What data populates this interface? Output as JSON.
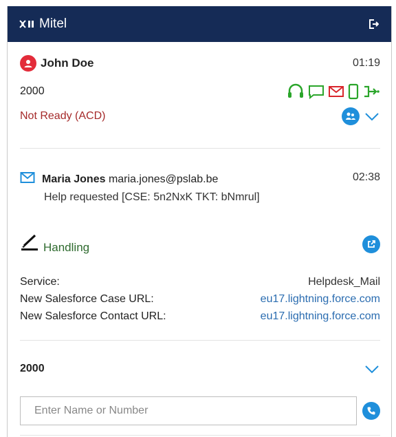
{
  "app": {
    "brand": "Mitel"
  },
  "agent": {
    "name": "John Doe",
    "time": "01:19",
    "extension": "2000",
    "status": "Not Ready (ACD)"
  },
  "mail": {
    "sender_name": "Maria Jones",
    "sender_email": "maria.jones@pslab.be",
    "time": "02:38",
    "subject": "Help requested [CSE: 5n2NxK TKT: bNmrul]"
  },
  "handling": {
    "label": "Handling"
  },
  "details": [
    {
      "label": "Service:",
      "value": "Helpdesk_Mail",
      "link": false
    },
    {
      "label": "New Salesforce Case URL:",
      "value": "eu17.lightning.force.com",
      "link": true
    },
    {
      "label": "New Salesforce Contact URL:",
      "value": "eu17.lightning.force.com",
      "link": true
    }
  ],
  "queue": {
    "label": "2000"
  },
  "dialer": {
    "placeholder": "Enter Name or Number"
  },
  "colors": {
    "header_bg": "#152b56",
    "channel_green": "#2aa52a",
    "channel_red": "#d9252c",
    "accent_blue": "#1f8fdb",
    "status_red": "#a52a2a"
  },
  "icons": {
    "logo": "mitel-logo-icon",
    "logout": "logout-icon",
    "avatar": "user-avatar-icon",
    "channels": [
      "headset-icon",
      "chat-icon",
      "email-icon",
      "mobile-icon",
      "routing-icon"
    ],
    "team": "team-icon",
    "expand": "chevron-down-icon",
    "mail": "envelope-icon",
    "handling": "pen-icon",
    "open_external": "external-link-icon",
    "call": "phone-icon"
  }
}
